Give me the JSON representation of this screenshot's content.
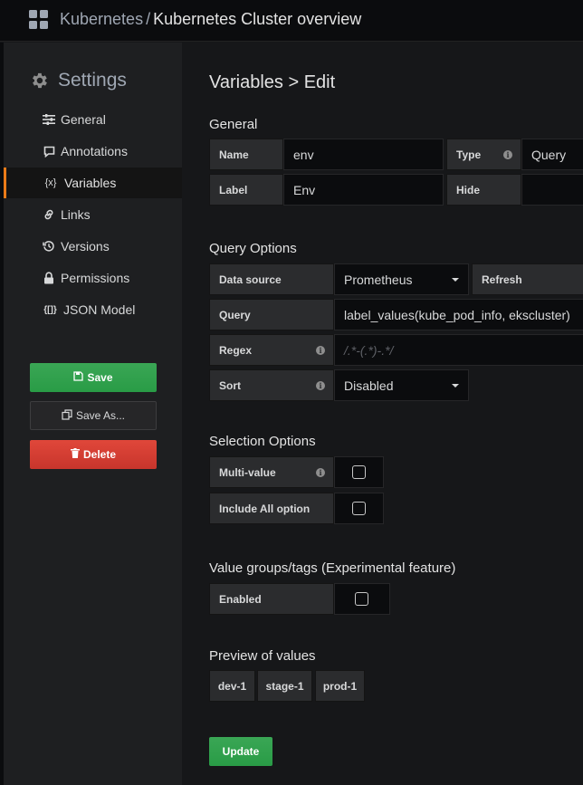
{
  "breadcrumb": {
    "folder": "Kubernetes",
    "separator": "/",
    "title": "Kubernetes Cluster overview"
  },
  "sidebar": {
    "title": "Settings",
    "items": [
      {
        "label": "General",
        "icon": "sliders-icon"
      },
      {
        "label": "Annotations",
        "icon": "comment-icon"
      },
      {
        "label": "Variables",
        "icon": "variable-icon",
        "glyph": "{x}",
        "active": true
      },
      {
        "label": "Links",
        "icon": "link-icon"
      },
      {
        "label": "Versions",
        "icon": "history-icon"
      },
      {
        "label": "Permissions",
        "icon": "lock-icon"
      },
      {
        "label": "JSON Model",
        "icon": "json-icon",
        "glyph": "{[]}"
      }
    ],
    "actions": {
      "save": "Save",
      "save_as": "Save As...",
      "delete": "Delete"
    }
  },
  "page": {
    "title": "Variables > Edit"
  },
  "general": {
    "heading": "General",
    "name_label": "Name",
    "name_value": "env",
    "type_label": "Type",
    "type_value": "Query",
    "label_label": "Label",
    "label_value": "Env",
    "hide_label": "Hide",
    "hide_value": ""
  },
  "query_options": {
    "heading": "Query Options",
    "datasource_label": "Data source",
    "datasource_value": "Prometheus",
    "refresh_label": "Refresh",
    "query_label": "Query",
    "query_value": "label_values(kube_pod_info, ekscluster)",
    "regex_label": "Regex",
    "regex_placeholder": "/.*-(.*)-.*/",
    "sort_label": "Sort",
    "sort_value": "Disabled"
  },
  "selection_options": {
    "heading": "Selection Options",
    "multi_value_label": "Multi-value",
    "multi_value_checked": false,
    "include_all_label": "Include All option",
    "include_all_checked": false
  },
  "value_groups": {
    "heading": "Value groups/tags (Experimental feature)",
    "enabled_label": "Enabled",
    "enabled_checked": false
  },
  "preview": {
    "heading": "Preview of values",
    "values": [
      "dev-1",
      "stage-1",
      "prod-1"
    ]
  },
  "update_label": "Update",
  "colors": {
    "accent": "#eb7b18",
    "save": "#299c46",
    "delete": "#d44a3a"
  }
}
